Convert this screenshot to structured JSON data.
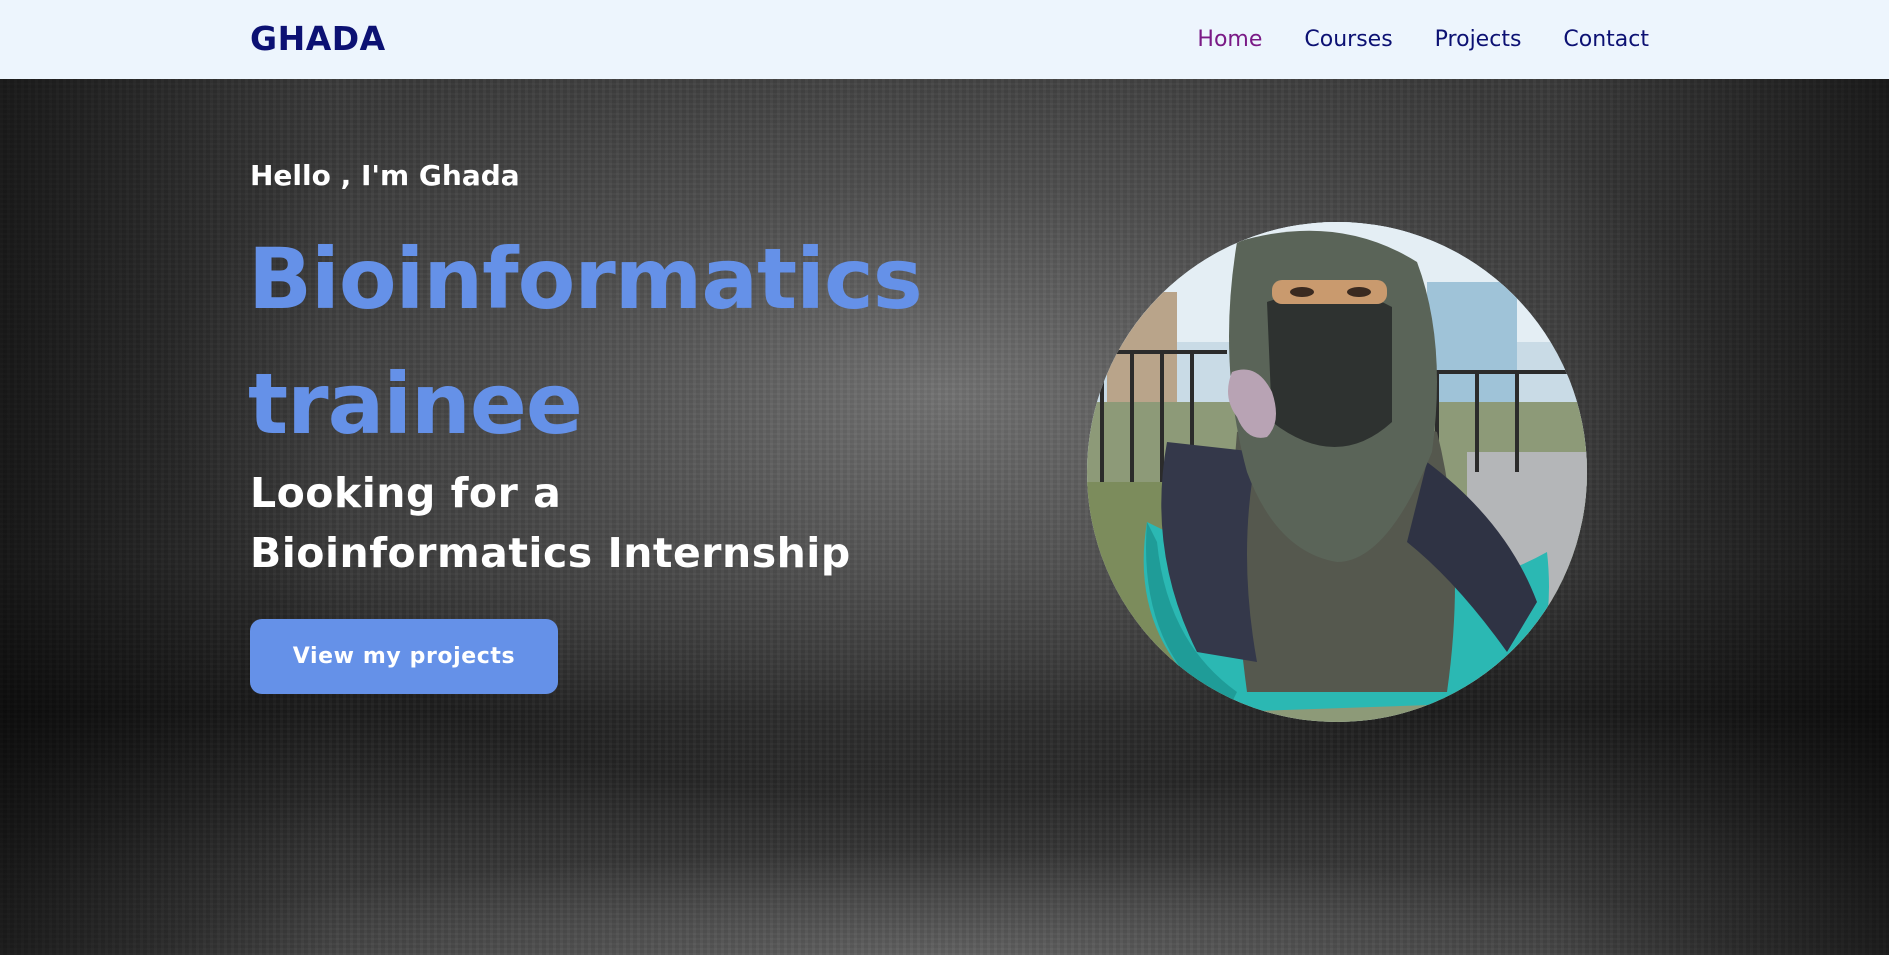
{
  "brand": {
    "name": "GHADA"
  },
  "nav": {
    "items": [
      {
        "label": "Home",
        "active": true
      },
      {
        "label": "Courses",
        "active": false
      },
      {
        "label": "Projects",
        "active": false
      },
      {
        "label": "Contact",
        "active": false
      }
    ]
  },
  "hero": {
    "greeting": "Hello , I'm Ghada",
    "headline": "Bioinformatics trainee",
    "subheadline": "Looking for a Bioinformatics Internship",
    "cta_label": "View my projects"
  },
  "colors": {
    "nav_bg": "#edf5fd",
    "brand": "#0c1173",
    "nav_active": "#7a1a86",
    "accent": "#6591e8",
    "text_light": "#ffffff"
  }
}
